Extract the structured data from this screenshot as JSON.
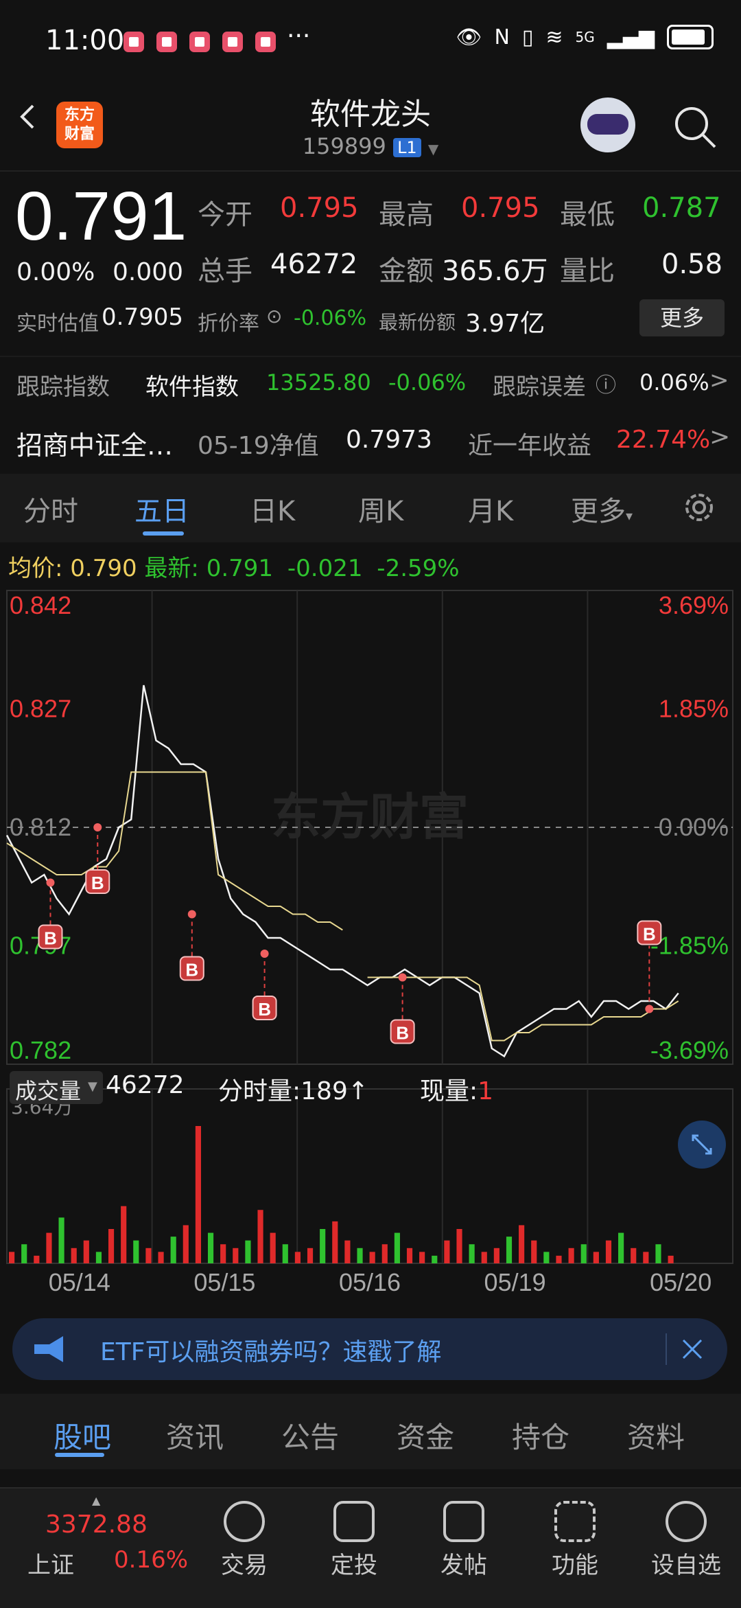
{
  "status_bar": {
    "time": "11:00",
    "more": "···",
    "network": "5G"
  },
  "header": {
    "title": "软件龙头",
    "code": "159899",
    "level_badge": "L1"
  },
  "quote": {
    "price": "0.791",
    "change_pct": "0.00%",
    "change": "0.000",
    "open_label": "今开",
    "open": "0.795",
    "high_label": "最高",
    "high": "0.795",
    "low_label": "最低",
    "low": "0.787",
    "volume_label": "总手",
    "volume": "46272",
    "amount_label": "金额",
    "amount": "365.6万",
    "ratio_label": "量比",
    "ratio": "0.58",
    "iopv_label": "实时估值",
    "iopv": "0.7905",
    "discount_label": "折价率",
    "discount": "-0.06%",
    "shares_label": "最新份额",
    "shares": "3.97亿",
    "more_button": "更多"
  },
  "tracking": {
    "label": "跟踪指数",
    "index_name": "软件指数",
    "index_value": "13525.80",
    "index_change": "-0.06%",
    "error_label": "跟踪误差",
    "error_value": "0.06%",
    "arrow": ">"
  },
  "fund": {
    "name": "招商中证全…",
    "nav_label": "05-19净值",
    "nav": "0.7973",
    "return_label": "近一年收益",
    "return": "22.74%",
    "arrow": ">"
  },
  "tabs": [
    {
      "label": "分时",
      "active": false
    },
    {
      "label": "五日",
      "active": true
    },
    {
      "label": "日K",
      "active": false
    },
    {
      "label": "周K",
      "active": false
    },
    {
      "label": "月K",
      "active": false
    },
    {
      "label": "更多",
      "active": false
    }
  ],
  "chart_info": {
    "avg_label": "均价:",
    "avg": "0.790",
    "last_label": "最新:",
    "last": "0.791",
    "change": "-0.021",
    "change_pct": "-2.59%"
  },
  "chart_data": {
    "type": "line",
    "title": "",
    "x": [
      "05/14",
      "05/15",
      "05/16",
      "05/19",
      "05/20"
    ],
    "y_left_ticks": [
      "0.842",
      "0.827",
      "0.812",
      "0.797",
      "0.782"
    ],
    "y_right_ticks": [
      "3.69%",
      "1.85%",
      "0.00%",
      "-1.85%",
      "-3.69%"
    ],
    "ylim": [
      0.782,
      0.842
    ],
    "reference": 0.812,
    "watermark": "东方财富",
    "buy_marker": "B",
    "series": [
      {
        "name": "最新",
        "color": "#f2f2f2",
        "values": [
          0.811,
          0.808,
          0.805,
          0.806,
          0.803,
          0.801,
          0.804,
          0.807,
          0.808,
          0.812,
          0.813,
          0.83,
          0.823,
          0.822,
          0.82,
          0.82,
          0.819,
          0.808,
          0.803,
          0.801,
          0.8,
          0.798,
          0.798,
          0.797,
          0.796,
          0.795,
          0.794,
          0.794,
          0.793,
          0.792,
          0.793,
          0.793,
          0.794,
          0.793,
          0.792,
          0.793,
          0.793,
          0.792,
          0.791,
          0.784,
          0.783,
          0.786,
          0.787,
          0.788,
          0.789,
          0.789,
          0.79,
          0.788,
          0.79,
          0.79,
          0.789,
          0.79,
          0.79,
          0.789,
          0.791
        ]
      },
      {
        "name": "均价",
        "color": "#e8d890",
        "values": [
          0.81,
          0.809,
          0.808,
          0.807,
          0.806,
          0.806,
          0.806,
          0.807,
          0.807,
          0.809,
          0.819,
          0.819,
          0.819,
          0.819,
          0.819,
          0.819,
          0.819,
          0.806,
          0.805,
          0.804,
          0.803,
          0.802,
          0.802,
          0.801,
          0.801,
          0.8,
          0.8,
          0.799,
          null,
          0.793,
          0.793,
          0.793,
          0.793,
          0.793,
          0.793,
          0.793,
          0.793,
          0.793,
          0.792,
          0.785,
          0.785,
          0.786,
          0.786,
          0.787,
          0.787,
          0.787,
          0.787,
          0.787,
          0.788,
          0.788,
          0.788,
          0.788,
          0.789,
          0.789,
          0.79
        ]
      }
    ],
    "buy_points": [
      {
        "x": 0.06,
        "y": 0.805
      },
      {
        "x": 0.125,
        "y": 0.812
      },
      {
        "x": 0.255,
        "y": 0.801
      },
      {
        "x": 0.355,
        "y": 0.796
      },
      {
        "x": 0.545,
        "y": 0.793
      },
      {
        "x": 0.885,
        "y": 0.789
      }
    ],
    "volume": {
      "label": "成交量",
      "total": "46272",
      "tick_label": "分时量:189",
      "now_label": "现量:",
      "now": "1",
      "max_label": "3.64万",
      "values": [
        3,
        5,
        2,
        8,
        12,
        4,
        6,
        3,
        9,
        15,
        6,
        4,
        3,
        7,
        10,
        36,
        8,
        5,
        4,
        6,
        14,
        8,
        5,
        3,
        4,
        9,
        11,
        6,
        4,
        3,
        5,
        8,
        4,
        3,
        2,
        6,
        9,
        5,
        3,
        4,
        7,
        10,
        6,
        3,
        2,
        4,
        5,
        3,
        6,
        8,
        4,
        3,
        5,
        2
      ]
    }
  },
  "banner": {
    "text": "ETF可以融资融券吗？速戳了解"
  },
  "bottom_tabs": [
    {
      "label": "股吧",
      "active": true
    },
    {
      "label": "资讯",
      "active": false
    },
    {
      "label": "公告",
      "active": false
    },
    {
      "label": "资金",
      "active": false
    },
    {
      "label": "持仓",
      "active": false
    },
    {
      "label": "资料",
      "active": false
    }
  ],
  "nav": {
    "index_value": "3372.88",
    "index_name": "上证",
    "index_change": "0.16%",
    "items": [
      "交易",
      "定投",
      "发帖",
      "功能",
      "设自选"
    ]
  },
  "colors": {
    "up": "#f23a3a",
    "down": "#2fc22f",
    "accent": "#5b9ff0",
    "avg_line": "#e8d890"
  }
}
